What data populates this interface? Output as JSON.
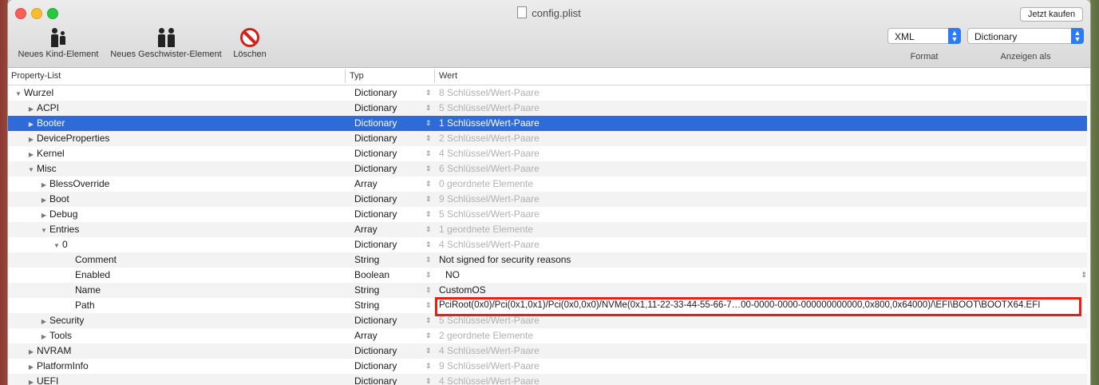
{
  "window": {
    "title": "config.plist",
    "buy_button": "Jetzt kaufen"
  },
  "toolbar": {
    "new_child": "Neues Kind-Element",
    "new_sibling": "Neues Geschwister-Element",
    "delete": "Löschen",
    "format_value": "XML",
    "format_label": "Format",
    "view_value": "Dictionary",
    "view_label": "Anzeigen als"
  },
  "columns": {
    "name": "Property-List",
    "type": "Typ",
    "value": "Wert"
  },
  "rows": [
    {
      "name": "Wurzel",
      "type": "Dictionary",
      "value": "8 Schlüssel/Wert-Paare"
    },
    {
      "name": "ACPI",
      "type": "Dictionary",
      "value": "5 Schlüssel/Wert-Paare"
    },
    {
      "name": "Booter",
      "type": "Dictionary",
      "value": "1 Schlüssel/Wert-Paare"
    },
    {
      "name": "DeviceProperties",
      "type": "Dictionary",
      "value": "2 Schlüssel/Wert-Paare"
    },
    {
      "name": "Kernel",
      "type": "Dictionary",
      "value": "4 Schlüssel/Wert-Paare"
    },
    {
      "name": "Misc",
      "type": "Dictionary",
      "value": "6 Schlüssel/Wert-Paare"
    },
    {
      "name": "BlessOverride",
      "type": "Array",
      "value": "0 geordnete Elemente"
    },
    {
      "name": "Boot",
      "type": "Dictionary",
      "value": "9 Schlüssel/Wert-Paare"
    },
    {
      "name": "Debug",
      "type": "Dictionary",
      "value": "5 Schlüssel/Wert-Paare"
    },
    {
      "name": "Entries",
      "type": "Array",
      "value": "1 geordnete Elemente"
    },
    {
      "name": "0",
      "type": "Dictionary",
      "value": "4 Schlüssel/Wert-Paare"
    },
    {
      "name": "Comment",
      "type": "String",
      "value": "Not signed for security reasons"
    },
    {
      "name": "Enabled",
      "type": "Boolean",
      "value": "NO"
    },
    {
      "name": "Name",
      "type": "String",
      "value": "CustomOS"
    },
    {
      "name": "Path",
      "type": "String",
      "value": "PciRoot(0x0)/Pci(0x1,0x1)/Pci(0x0,0x0)/NVMe(0x1,11-22-33-44-55-66-7…00-0000-0000-000000000000,0x800,0x64000)/\\EFI\\BOOT\\BOOTX64.EFI"
    },
    {
      "name": "Security",
      "type": "Dictionary",
      "value": "5 Schlüssel/Wert-Paare"
    },
    {
      "name": "Tools",
      "type": "Array",
      "value": "2 geordnete Elemente"
    },
    {
      "name": "NVRAM",
      "type": "Dictionary",
      "value": "4 Schlüssel/Wert-Paare"
    },
    {
      "name": "PlatformInfo",
      "type": "Dictionary",
      "value": "9 Schlüssel/Wert-Paare"
    },
    {
      "name": "UEFI",
      "type": "Dictionary",
      "value": "4 Schlüssel/Wert-Paare"
    }
  ],
  "colors": {
    "selection": "#2f6bd6",
    "highlight_box": "#e32118"
  }
}
